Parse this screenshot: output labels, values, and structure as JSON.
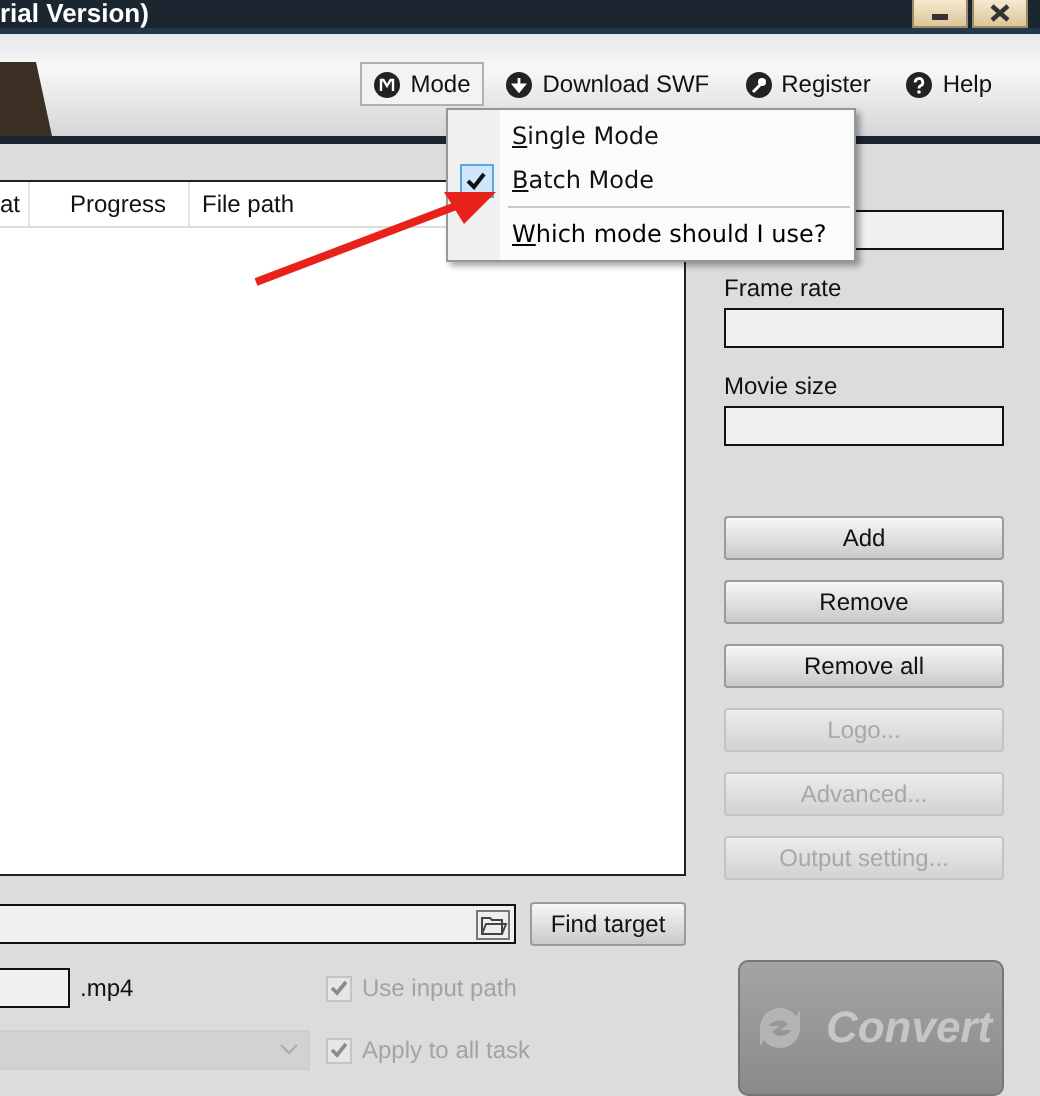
{
  "window": {
    "title": "rial Version)"
  },
  "toolbar": [
    {
      "kind": "mode",
      "label": "Mode",
      "pressed": true
    },
    {
      "kind": "download",
      "label": "Download SWF",
      "pressed": false
    },
    {
      "kind": "register",
      "label": "Register",
      "pressed": false
    },
    {
      "kind": "help",
      "label": "Help",
      "pressed": false
    }
  ],
  "mode_menu": [
    {
      "kind": "option",
      "label": "Single Mode",
      "checked": false
    },
    {
      "kind": "option",
      "label": "Batch Mode",
      "checked": true
    },
    {
      "kind": "separator"
    },
    {
      "kind": "link",
      "label": "Which mode should I use?"
    }
  ],
  "file_list": {
    "columns": [
      "at",
      "Progress",
      "File path"
    ]
  },
  "properties": {
    "fields": [
      {
        "label": "Frame rate"
      },
      {
        "label": "Movie size"
      }
    ]
  },
  "buttons": [
    {
      "label": "Add",
      "disabled": false
    },
    {
      "label": "Remove",
      "disabled": false
    },
    {
      "label": "Remove all",
      "disabled": false
    },
    {
      "label": "Logo...",
      "disabled": true
    },
    {
      "label": "Advanced...",
      "disabled": true
    },
    {
      "label": "Output setting...",
      "disabled": true
    }
  ],
  "output": {
    "find_button": "Find target",
    "extension": ".mp4",
    "options": [
      {
        "label": "Use input path",
        "checked": true,
        "disabled": true
      },
      {
        "label": "Apply to all task",
        "checked": true,
        "disabled": true
      }
    ]
  },
  "convert_button": {
    "label": "Convert",
    "disabled": true
  }
}
